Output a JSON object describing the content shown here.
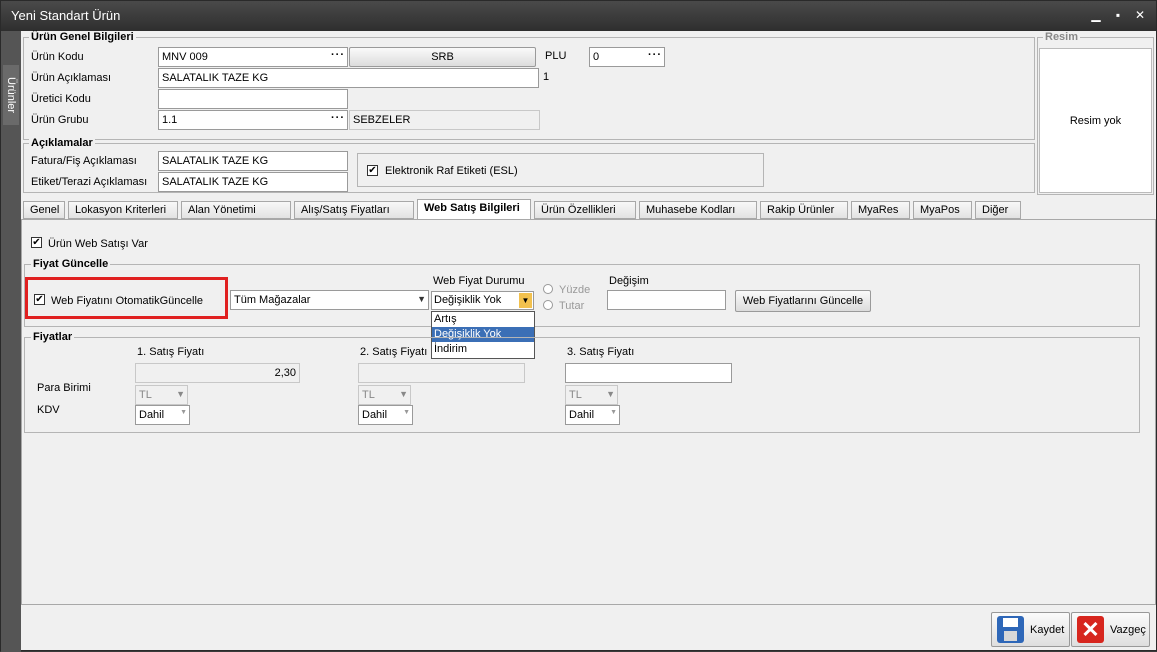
{
  "window": {
    "title": "Yeni Standart Ürün",
    "side_tab": "Ürünler"
  },
  "general": {
    "title": "Ürün Genel Bilgileri",
    "code_label": "Ürün Kodu",
    "code_value": "MNV 009",
    "unit_button": "SRB",
    "plu_label": "PLU",
    "plu_value": "0",
    "desc_label": "Ürün Açıklaması",
    "desc_value": "SALATALIK TAZE KG",
    "desc_suffix": "1",
    "maker_label": "Üretici Kodu",
    "maker_value": "",
    "group_label": "Ürün Grubu",
    "group_value": "1.1",
    "group_name": "SEBZELER"
  },
  "image": {
    "title": "Resim",
    "empty_text": "Resim yok"
  },
  "notes": {
    "title": "Açıklamalar",
    "invoice_label": "Fatura/Fiş Açıklaması",
    "invoice_value": "SALATALIK TAZE KG",
    "label_label": "Etiket/Terazi Açıklaması",
    "label_value": "SALATALIK TAZE KG",
    "esl_label": "Elektronik Raf Etiketi (ESL)"
  },
  "tabs": [
    "Genel",
    "Lokasyon Kriterleri",
    "Alan Yönetimi",
    "Alış/Satış Fiyatları",
    "Web Satış Bilgileri",
    "Ürün Özellikleri",
    "Muhasebe Kodları",
    "Rakip Ürünler",
    "MyaRes",
    "MyaPos",
    "Diğer"
  ],
  "web": {
    "web_sale_label": "Ürün Web Satışı Var",
    "price_update": {
      "title": "Fiyat Güncelle",
      "auto_label": "Web Fiyatını OtomatikGüncelle",
      "store_value": "Tüm Mağazalar",
      "status_label": "Web Fiyat Durumu",
      "status_value": "Değişiklik Yok",
      "status_options": [
        "Artış",
        "Değişiklik Yok",
        "İndirim"
      ],
      "percent_label": "Yüzde",
      "amount_label": "Tutar",
      "change_label": "Değişim",
      "change_value": "",
      "update_button": "Web Fiyatlarını Güncelle"
    },
    "prices": {
      "title": "Fiyatlar",
      "currency_label": "Para Birimi",
      "vat_label": "KDV",
      "columns": [
        {
          "label": "1. Satış Fiyatı",
          "value": "2,30",
          "currency": "TL",
          "vat": "Dahil"
        },
        {
          "label": "2. Satış Fiyatı",
          "value": "",
          "currency": "TL",
          "vat": "Dahil"
        },
        {
          "label": "3. Satış Fiyatı",
          "value": "",
          "currency": "TL",
          "vat": "Dahil"
        }
      ]
    }
  },
  "footer": {
    "save": "Kaydet",
    "cancel": "Vazgeç"
  },
  "colors": {
    "highlight": "#e02020",
    "selected": "#3b6fb6"
  }
}
